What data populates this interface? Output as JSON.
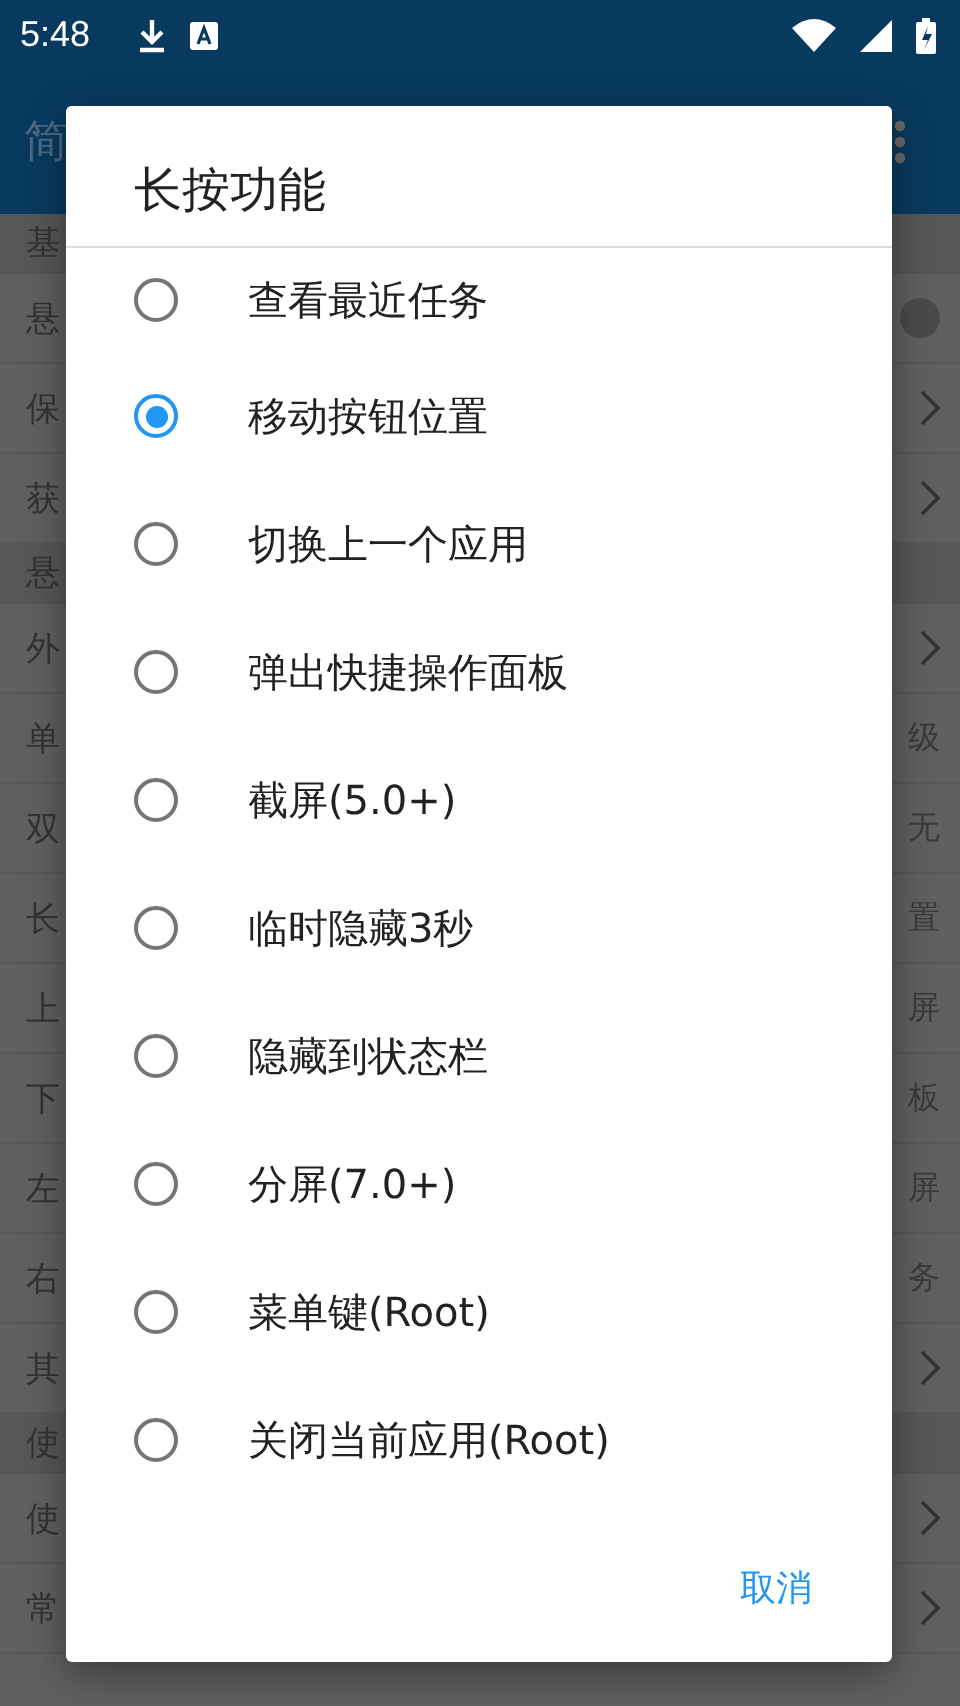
{
  "status_bar": {
    "time": "5:48"
  },
  "app_bar": {
    "title": "简"
  },
  "settings_list": [
    {
      "kind": "header",
      "text": "基"
    },
    {
      "kind": "switch",
      "text": "悬",
      "on": false
    },
    {
      "kind": "chevron",
      "text": "保"
    },
    {
      "kind": "chevron",
      "text": "获"
    },
    {
      "kind": "header",
      "text": "悬"
    },
    {
      "kind": "chevron",
      "text": "外"
    },
    {
      "kind": "value",
      "text": "单",
      "value": "级"
    },
    {
      "kind": "value",
      "text": "双",
      "value": "无"
    },
    {
      "kind": "value",
      "text": "长",
      "value": "置"
    },
    {
      "kind": "value",
      "text": "上",
      "value": "屏"
    },
    {
      "kind": "value",
      "text": "下",
      "value": "板"
    },
    {
      "kind": "value",
      "text": "左",
      "value": "屏"
    },
    {
      "kind": "value",
      "text": "右",
      "value": "务"
    },
    {
      "kind": "chevron",
      "text": "其"
    },
    {
      "kind": "header",
      "text": "使"
    },
    {
      "kind": "chevron",
      "text": "使"
    },
    {
      "kind": "chevron",
      "text": "常"
    }
  ],
  "dialog": {
    "title": "长按功能",
    "options": [
      {
        "label": "查看最近任务",
        "selected": false
      },
      {
        "label": "移动按钮位置",
        "selected": true
      },
      {
        "label": "切换上一个应用",
        "selected": false
      },
      {
        "label": "弹出快捷操作面板",
        "selected": false
      },
      {
        "label": "截屏(5.0+)",
        "selected": false
      },
      {
        "label": "临时隐藏3秒",
        "selected": false
      },
      {
        "label": "隐藏到状态栏",
        "selected": false
      },
      {
        "label": "分屏(7.0+)",
        "selected": false
      },
      {
        "label": "菜单键(Root)",
        "selected": false
      },
      {
        "label": "关闭当前应用(Root)",
        "selected": false
      }
    ],
    "cancel": "取消"
  }
}
